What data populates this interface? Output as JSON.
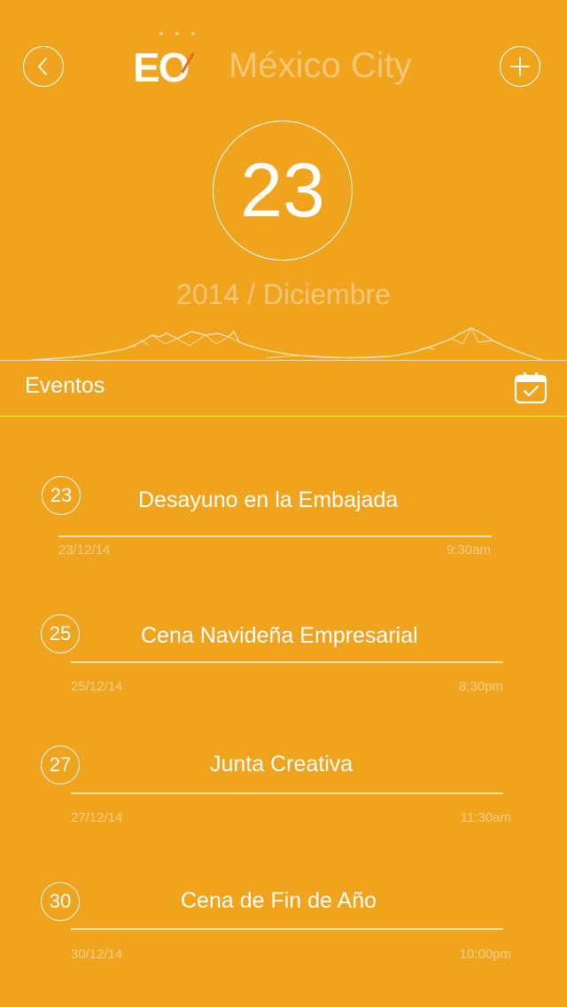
{
  "header": {
    "back_icon": "chevron-left-icon",
    "logo_text": "EO",
    "city": "México City",
    "add_icon": "plus-icon"
  },
  "date": {
    "day": "23",
    "month_year": "2014 / Diciembre"
  },
  "section": {
    "title": "Eventos",
    "icon": "calendar-check-icon"
  },
  "events": [
    {
      "day": "23",
      "title": "Desayuno en la Embajada",
      "date": "23/12/14",
      "time": "9:30am"
    },
    {
      "day": "25",
      "title": "Cena Navideña Empresarial",
      "date": "25/12/14",
      "time": "8:30pm"
    },
    {
      "day": "27",
      "title": "Junta Creativa",
      "date": "27/12/14",
      "time": "11:30am"
    },
    {
      "day": "30",
      "title": "Cena de Fin de Año",
      "date": "30/12/14",
      "time": "10:00pm"
    }
  ],
  "colors": {
    "background": "#F0A31C",
    "accent_light": "#F7C777",
    "logo_accent": "#E56A1E"
  }
}
